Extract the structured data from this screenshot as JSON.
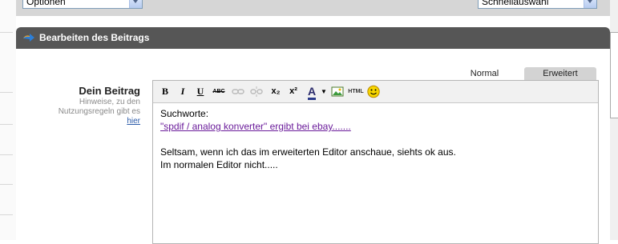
{
  "top_bar": {
    "options_select": {
      "value": "Optionen"
    },
    "quick_select": {
      "value": "Schnellauswahl"
    }
  },
  "panel": {
    "title": "Bearbeiten des Beitrags",
    "field_label": "Dein Beitrag",
    "hint_text": "Hinweise, zu den Nutzungsregeln gibt es",
    "hint_link": "hier"
  },
  "tabs": {
    "normal": "Normal",
    "advanced": "Erweitert"
  },
  "toolbar": {
    "bold": "B",
    "italic": "I",
    "underline": "U",
    "strike": "ABC",
    "subscript": "x₂",
    "superscript": "x²",
    "font_color": "A",
    "html": "HTML",
    "icons": [
      "link-icon",
      "unlink-icon",
      "image-icon",
      "smiley-icon"
    ]
  },
  "editor_content": {
    "line1": "Suchworte:",
    "line2": "\"spdif / analog konverter\" ergibt bei ebay.......",
    "line3": "Seltsam, wenn ich das im erweiterten Editor anschaue, siehts ok aus.",
    "line4": "Im normalen Editor nicht....."
  },
  "colors": {
    "header": "#565656",
    "link": "#6a1b9a",
    "accent_arrow": "#2c7fd8"
  }
}
